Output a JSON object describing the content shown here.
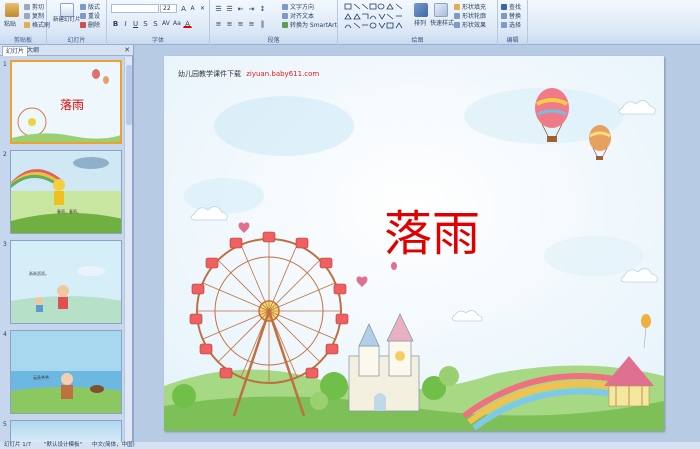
{
  "ribbon": {
    "clipboard": {
      "paste": "粘贴",
      "cut": "剪切",
      "copy": "复制",
      "format_painter": "格式刷",
      "label": "剪贴板"
    },
    "slides": {
      "new_slide": "新建幻灯片",
      "layout": "版式",
      "reset": "重设",
      "delete": "删除",
      "label": "幻灯片"
    },
    "font": {
      "size": "22",
      "label": "字体"
    },
    "paragraph": {
      "text_direction": "文字方向",
      "align_text": "对齐文本",
      "smartart": "转换为 SmartArt",
      "label": "段落"
    },
    "drawing": {
      "arrange": "排列",
      "quick_styles": "快速样式",
      "shape_fill": "形状填充",
      "shape_outline": "形状轮廓",
      "shape_effects": "形状效果",
      "label": "绘图"
    },
    "editing": {
      "find": "查找",
      "replace": "替换",
      "select": "选择",
      "label": "编辑"
    }
  },
  "panel": {
    "tabs": [
      "幻灯片",
      "大纲"
    ],
    "slide_numbers": [
      "1",
      "2",
      "3",
      "4",
      "5"
    ],
    "thumb_title": "落雨",
    "thumb2_caption": "春雨，春雨，",
    "thumb3_caption": "淅淅沥沥，",
    "thumb4_caption": "云朵爷爷"
  },
  "slide": {
    "header_text": "幼儿园教学课件下载",
    "header_url": "ziyuan.baby611.com",
    "title": "落雨"
  },
  "status": {
    "slide_info": "幻灯片 1/7",
    "theme": "\"默认设计模板\"",
    "language": "中文(简体，中国)"
  },
  "colors": {
    "title_red": "#e10000",
    "url_red": "#e02020",
    "ribbon_blue": "#dce8f6",
    "selection_orange": "#f0a030"
  }
}
